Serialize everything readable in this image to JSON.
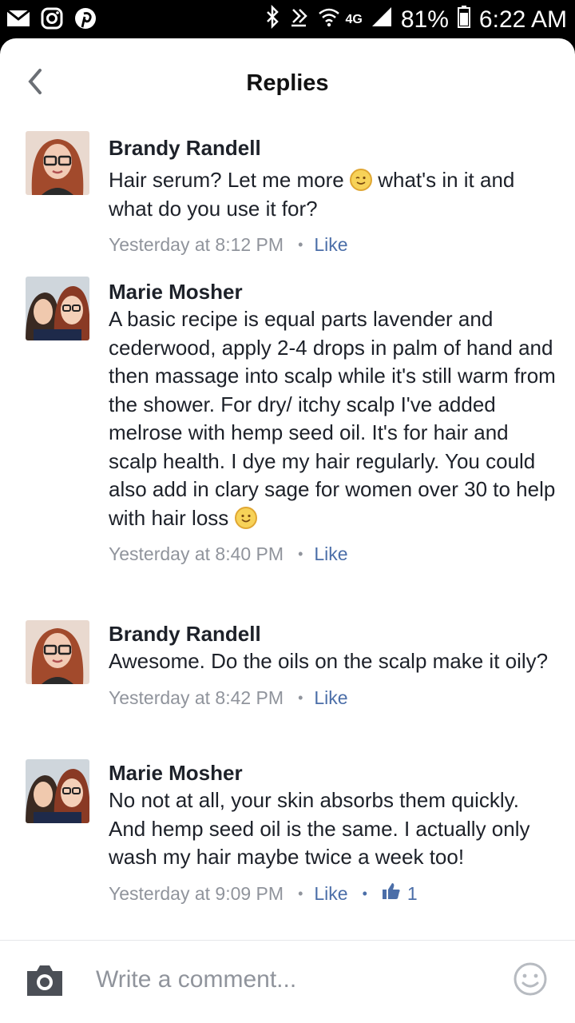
{
  "status_bar": {
    "battery": "81%",
    "time": "6:22 AM",
    "network": "4G",
    "left_icons": [
      "mail-icon",
      "instagram-icon",
      "pinterest-icon"
    ],
    "right_icons": [
      "bluetooth-icon",
      "nfc-icon",
      "wifi-icon",
      "signal-icon",
      "battery-icon"
    ]
  },
  "header": {
    "title": "Replies"
  },
  "comments": [
    {
      "author": "Brandy Randell",
      "text_part1": "Hair serum? Let me more ",
      "emoji": "wink-emoji",
      "text_part2": " what's in it and what do you use it for?",
      "time": "Yesterday at 8:12 PM",
      "like_label": "Like"
    },
    {
      "author": "Marie Mosher",
      "text_part1": "A basic recipe is equal parts lavender and cederwood, apply 2-4 drops in palm of hand and then massage into scalp while it's still warm from the shower. For dry/ itchy scalp I've added melrose with hemp seed oil. It's for hair and scalp health. I dye my hair regularly. You could also add in clary sage for women over 30 to help with hair loss ",
      "emoji": "smile-emoji",
      "time": "Yesterday at 8:40 PM",
      "like_label": "Like"
    },
    {
      "author": "Brandy Randell",
      "text_part1": "Awesome. Do the oils on the scalp make it oily?",
      "time": "Yesterday at 8:42 PM",
      "like_label": "Like"
    },
    {
      "author": "Marie Mosher",
      "text_part1": "No not at all, your skin absorbs them quickly. And hemp seed oil is the same. I actually only wash my hair maybe twice a week too!",
      "time": "Yesterday at 9:09 PM",
      "like_label": "Like",
      "like_count": "1"
    }
  ],
  "composer": {
    "placeholder": "Write a comment..."
  },
  "colors": {
    "link": "#4b6ea8",
    "meta": "#90949c",
    "text": "#1d2129"
  }
}
